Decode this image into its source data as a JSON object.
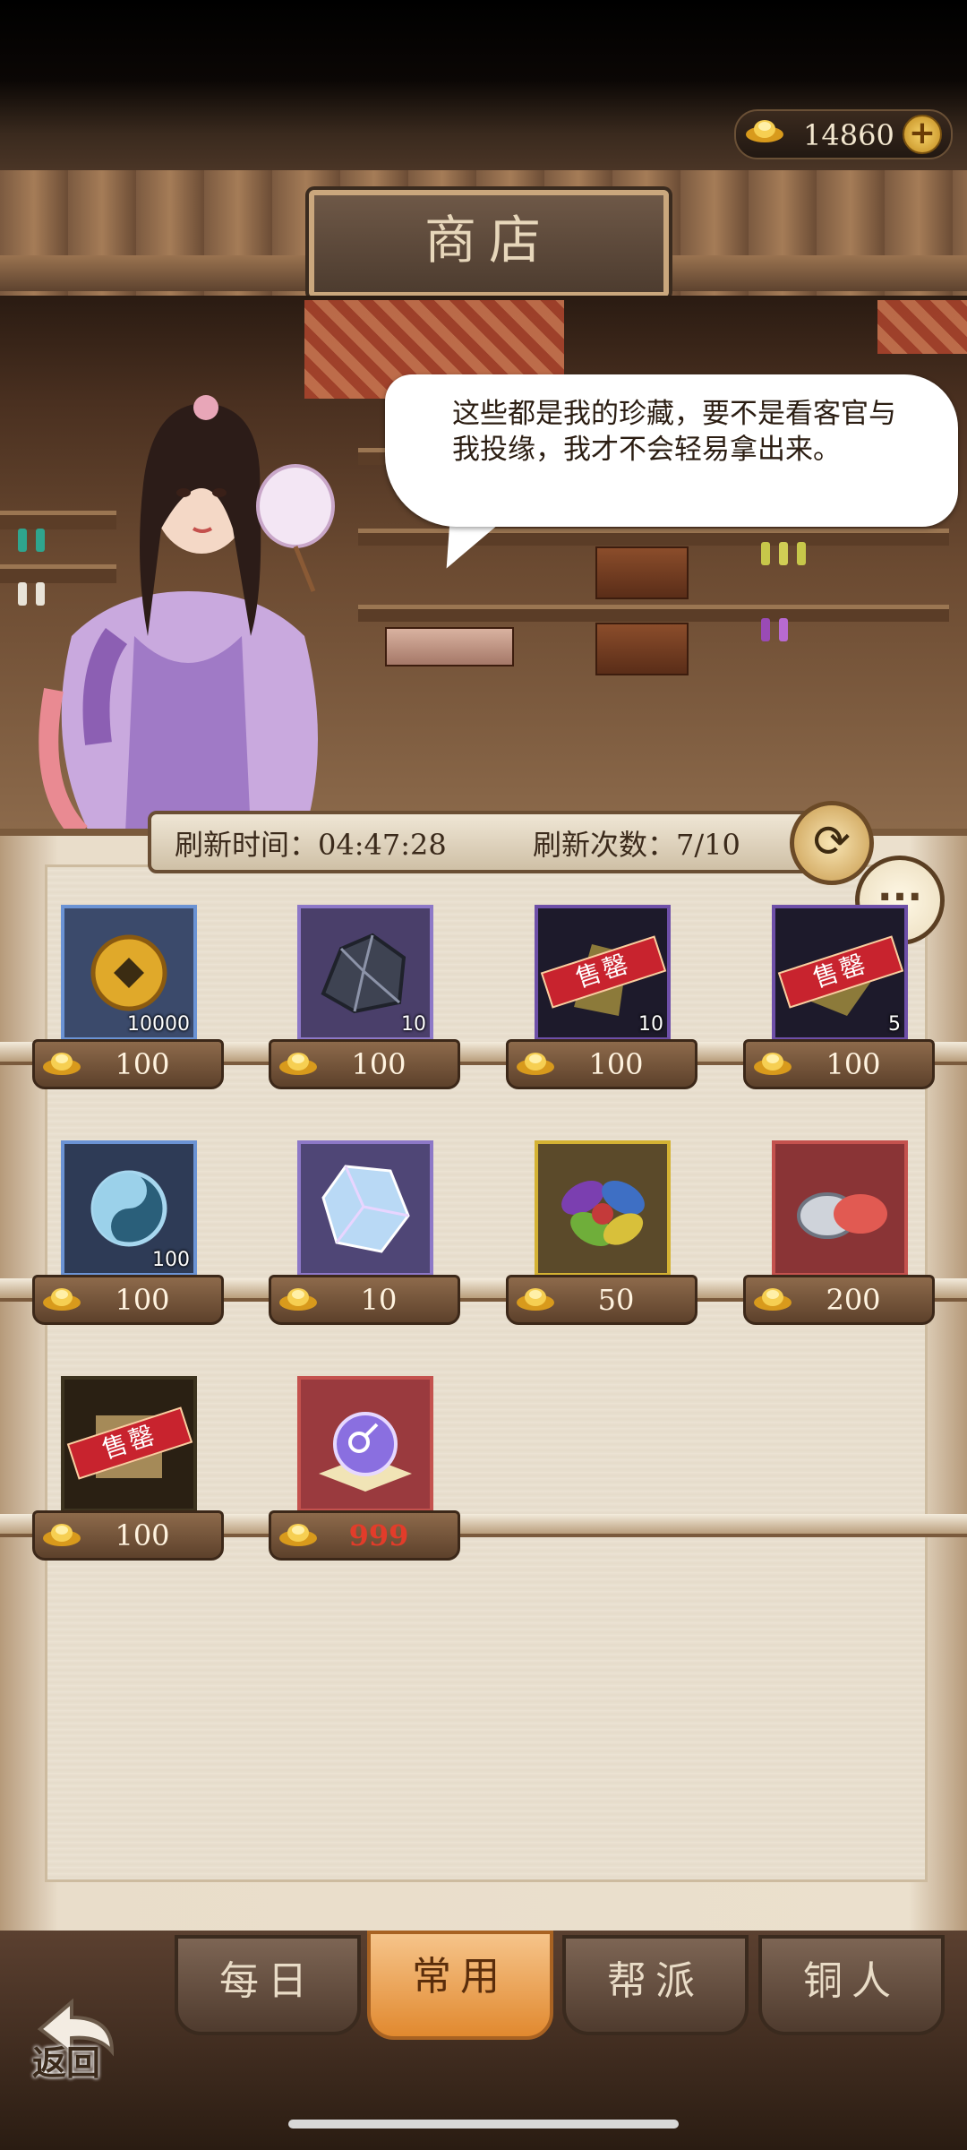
{
  "header": {
    "currency_amount": "14860",
    "title": "商店"
  },
  "npc": {
    "speech": "这些都是我的珍藏，要不是看客官与我投缘，我才不会轻易拿出来。"
  },
  "refresh": {
    "time_text": "刷新时间：04:47:28",
    "count_text": "刷新次数：7/10"
  },
  "items": [
    {
      "name": "copper-coin",
      "count": "10000",
      "price": "100",
      "sale_label": "",
      "colors": {
        "border": "#6b93d4",
        "bg": "#3b4a6b"
      }
    },
    {
      "name": "iron-ore",
      "count": "10",
      "price": "100",
      "sale_label": "",
      "colors": {
        "border": "#8d78c7",
        "bg": "#4a3f6a"
      }
    },
    {
      "name": "sold-out-item-1",
      "count": "10",
      "price": "100",
      "sale_label": "售罄",
      "colors": {
        "border": "#6e4fa8",
        "bg": "#1d1a2b"
      }
    },
    {
      "name": "sold-out-item-2",
      "count": "5",
      "price": "100",
      "sale_label": "售罄",
      "colors": {
        "border": "#6e4fa8",
        "bg": "#1d1a2b"
      }
    },
    {
      "name": "taiji-orb",
      "count": "100",
      "price": "100",
      "sale_label": "",
      "colors": {
        "border": "#6b93d4",
        "bg": "#2e3b56"
      }
    },
    {
      "name": "crystal-gem",
      "count": "",
      "price": "10",
      "sale_label": "",
      "colors": {
        "border": "#8d78c7",
        "bg": "#4f4676"
      }
    },
    {
      "name": "flower",
      "count": "",
      "price": "50",
      "sale_label": "",
      "colors": {
        "border": "#d4b233",
        "bg": "#5b4a2a"
      }
    },
    {
      "name": "rouge-box",
      "count": "",
      "price": "200",
      "sale_label": "",
      "colors": {
        "border": "#c4524e",
        "bg": "#8a3436"
      }
    },
    {
      "name": "sold-out-scroll",
      "count": "",
      "price": "100",
      "sale_label": "售罄",
      "colors": {
        "border": "#3c331f",
        "bg": "#2a2013"
      }
    },
    {
      "name": "gender-orb",
      "count": "",
      "price": "999",
      "sale_label": "",
      "colors": {
        "border": "#c4524e",
        "bg": "#9a3a3e"
      }
    }
  ],
  "tabs": [
    {
      "label": "每日",
      "active": false
    },
    {
      "label": "常用",
      "active": true
    },
    {
      "label": "帮派",
      "active": false
    },
    {
      "label": "铜人",
      "active": false
    }
  ],
  "nav": {
    "back_label": "返回"
  }
}
